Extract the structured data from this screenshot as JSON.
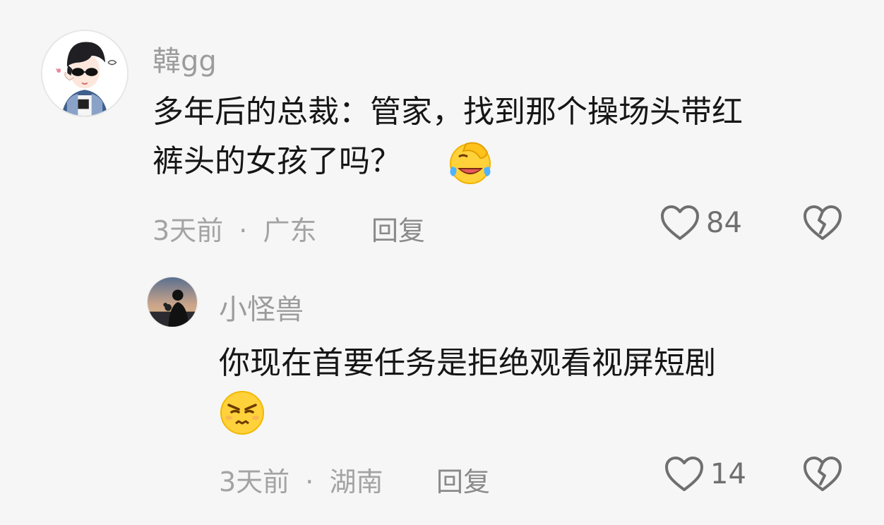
{
  "comments": [
    {
      "username": "韓gg",
      "text_line1": "多年后的总裁：管家，找到那个操场头带红",
      "text_line2": "裤头的女孩了吗？",
      "emoji": "facepalm-laugh-emoji",
      "time": "3天前",
      "separator": "·",
      "location": "广东",
      "reply_label": "回复",
      "likes": "84"
    },
    {
      "username": "小怪兽",
      "text_line1": "你现在首要任务是拒绝观看视屏短剧",
      "emoji": "annoyed-face-emoji",
      "time": "3天前",
      "separator": "·",
      "location": "湖南",
      "reply_label": "回复",
      "likes": "14"
    }
  ],
  "icons": {
    "like": "heart-outline-icon",
    "dislike": "broken-heart-icon"
  },
  "colors": {
    "background": "#f6f6f6",
    "username": "#9c9c9c",
    "text": "#161616",
    "meta": "#a3a3a3",
    "icon": "#6f6f6f"
  }
}
